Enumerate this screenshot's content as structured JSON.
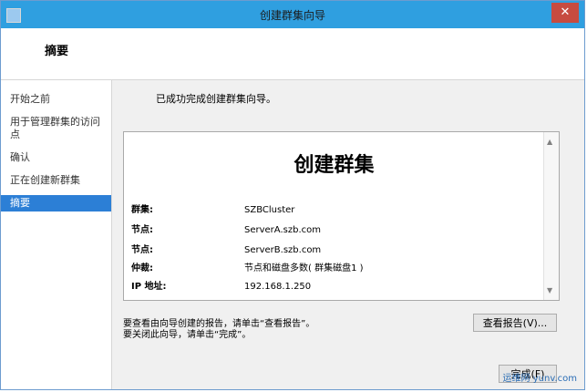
{
  "window": {
    "title": "创建群集向导",
    "close": "✕"
  },
  "header": {
    "heading": "摘要"
  },
  "sidebar": {
    "steps": [
      {
        "label": "开始之前",
        "active": false
      },
      {
        "label": "用于管理群集的访问点",
        "active": false
      },
      {
        "label": "确认",
        "active": false
      },
      {
        "label": "正在创建新群集",
        "active": false
      },
      {
        "label": "摘要",
        "active": true
      }
    ]
  },
  "main": {
    "success": "已成功完成创建群集向导。",
    "report": {
      "title": "创建群集",
      "rows": [
        {
          "label": "群集:",
          "value": "SZBCluster"
        },
        {
          "label": "节点:",
          "value": "ServerA.szb.com"
        },
        {
          "label": "节点:",
          "value": "ServerB.szb.com"
        },
        {
          "label": "仲裁:",
          "value": "节点和磁盘多数( 群集磁盘1 )"
        },
        {
          "label": "IP 地址:",
          "value": "192.168.1.250"
        }
      ]
    },
    "hint1": "要查看由向导创建的报告，请单击“查看报告”。",
    "hint2": "要关闭此向导，请单击“完成”。",
    "view_report_button": "查看报告(V)...",
    "finish_button": "完成(F)"
  },
  "watermark": "运维网 yunv.com"
}
